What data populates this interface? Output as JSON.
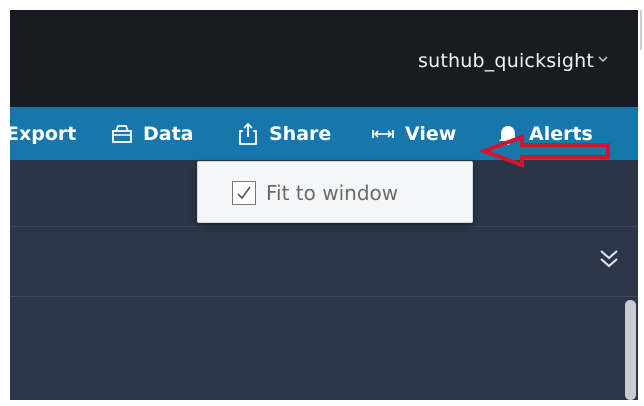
{
  "header": {
    "account_name": "suthub_quicksight",
    "account_caret_icon": "chevron-down-icon"
  },
  "toolbar": {
    "items": [
      {
        "label": "Export",
        "icon": "export-icon"
      },
      {
        "label": "Data",
        "icon": "database-icon"
      },
      {
        "label": "Share",
        "icon": "share-icon"
      },
      {
        "label": "View",
        "icon": "fit-arrows-icon"
      },
      {
        "label": "Alerts",
        "icon": "bell-icon"
      }
    ]
  },
  "view_menu": {
    "fit_to_window_label": "Fit to window",
    "fit_to_window_checked": true
  },
  "content": {
    "collapse_icon": "double-chevron-down-icon"
  },
  "annotation": {
    "arrow_color": "#d0162c",
    "arrow_icon": "red-arrow-left-icon"
  },
  "colors": {
    "top_bar": "#171c22",
    "toolbar": "#1777ad",
    "content": "#2c364a"
  }
}
